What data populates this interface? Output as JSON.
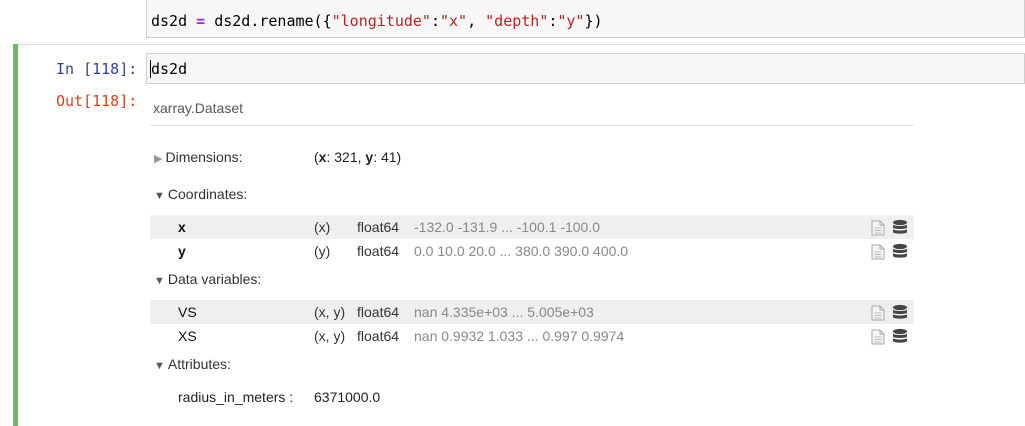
{
  "previous_cell": {
    "code_var": "ds2d",
    "code_op": "=",
    "code_call": "ds2d.rename({",
    "str_longitude": "\"longitude\"",
    "colon1": ":",
    "str_x": "\"x\"",
    "comma": ", ",
    "str_depth": "\"depth\"",
    "colon2": ":",
    "str_y": "\"y\"",
    "code_close": "})"
  },
  "cell": {
    "in_prompt": "In [118]:",
    "input_code": "ds2d",
    "out_prompt": "Out[118]:"
  },
  "dataset": {
    "header": "xarray.Dataset",
    "dimensions": {
      "title": "Dimensions:",
      "open_paren": "(",
      "x_name": "x",
      "x_value": ": 321, ",
      "y_name": "y",
      "y_value": ": 41)"
    },
    "coordinates": {
      "title": "Coordinates:",
      "items": [
        {
          "name": "x",
          "dims": "(x)",
          "dtype": "float64",
          "preview": "-132.0 -131.9 ... -100.1 -100.0"
        },
        {
          "name": "y",
          "dims": "(y)",
          "dtype": "float64",
          "preview": "0.0 10.0 20.0 ... 380.0 390.0 400.0"
        }
      ]
    },
    "data_variables": {
      "title": "Data variables:",
      "items": [
        {
          "name": "VS",
          "dims": "(x, y)",
          "dtype": "float64",
          "preview": "nan 4.335e+03 ... 5.005e+03"
        },
        {
          "name": "XS",
          "dims": "(x, y)",
          "dtype": "float64",
          "preview": "nan 0.9932 1.033 ... 0.997 0.9974"
        }
      ]
    },
    "attributes": {
      "title": "Attributes:",
      "items": [
        {
          "name": "radius_in_meters :",
          "value": "6371000.0"
        }
      ]
    }
  },
  "icons": {
    "collapsed_arrow": "triangle-right-icon",
    "expanded_arrow": "triangle-down-icon",
    "attrs": "document-icon",
    "data": "database-icon"
  },
  "colors": {
    "cell_selected_bar": "#66bb6a",
    "in_prompt": "#303f9f",
    "out_prompt": "#d84315",
    "string": "#ba2121",
    "operator": "#aa22ff"
  }
}
